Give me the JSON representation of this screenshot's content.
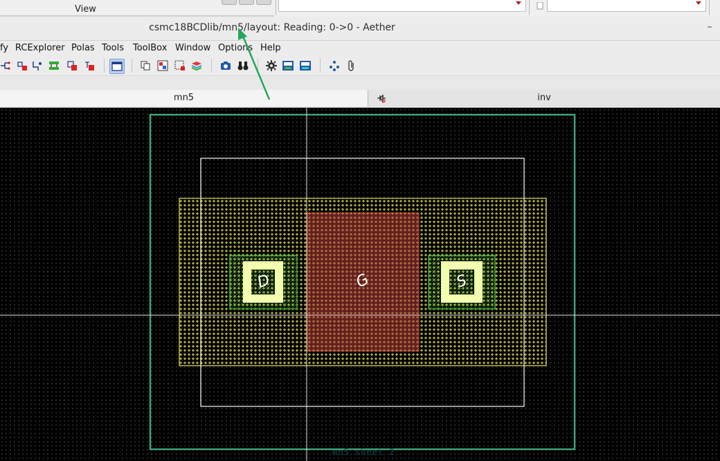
{
  "top_panel": {
    "view_label": "View"
  },
  "window": {
    "title": "csmc18BCDlib/mn5/layout: Reading: 0->0 - Aether",
    "minimize_glyph": "–"
  },
  "menu": {
    "items": [
      "fy",
      "RCExplorer",
      "Polas",
      "Tools",
      "ToolBox",
      "Window",
      "Options",
      "Help"
    ]
  },
  "toolbar": {
    "icons": [
      "net-icon",
      "pin-red-icon",
      "wire-icon",
      "bus-green-icon",
      "instance-red-icon",
      "label-red-icon",
      "layout-window-icon",
      "copy-icon",
      "palette-icon",
      "select-box-icon",
      "layers-icon",
      "capture-icon",
      "binoculars-icon",
      "gear-icon",
      "drc-icon",
      "lvs-icon",
      "hierarchy-icon",
      "paperclip-icon"
    ]
  },
  "tabs": [
    {
      "label": "mn5",
      "active": true
    },
    {
      "label": "inv",
      "active": false
    }
  ],
  "layout": {
    "pin_labels": [
      "D",
      "G",
      "S"
    ],
    "colors": {
      "boundary": "#3fa37a",
      "outline": "#ffffff",
      "active_area": "#e8e85a",
      "poly": "#c04040",
      "contact_well": "#3aa83a",
      "contact": "#f2ffb0",
      "crosshair": "#e8e8e8"
    }
  },
  "annotation": {
    "arrow_color": "#22a85a"
  },
  "status": {
    "text": "mn5 sheet 2"
  }
}
